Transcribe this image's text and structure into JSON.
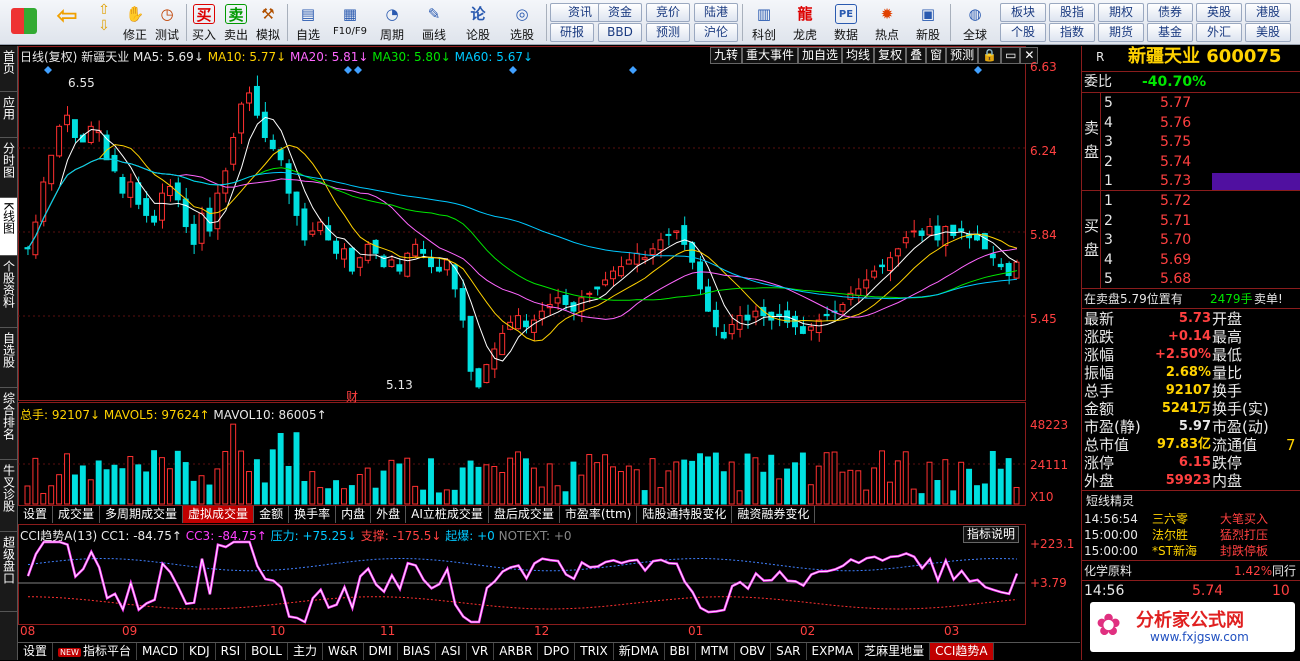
{
  "toolbar": {
    "buttons": [
      {
        "name": "app-icon",
        "label": ""
      },
      {
        "name": "back-button",
        "label": ""
      },
      {
        "name": "modify-button",
        "label": "修正"
      },
      {
        "name": "backtest-button",
        "label": "测试"
      },
      {
        "name": "buy-button",
        "label": "买入",
        "icon": "买"
      },
      {
        "name": "sell-button",
        "label": "卖出",
        "icon": "卖"
      },
      {
        "name": "simulate-button",
        "label": "模拟"
      },
      {
        "name": "watchlist-button",
        "label": "自选"
      },
      {
        "name": "f10-button",
        "label": "F10/F9"
      },
      {
        "name": "period-button",
        "label": "周期"
      },
      {
        "name": "draw-button",
        "label": "画线"
      },
      {
        "name": "forum-button",
        "label": "论股"
      },
      {
        "name": "stockpick-button",
        "label": "选股"
      }
    ],
    "grid_left": [
      [
        "资讯",
        "资金",
        "竞价",
        "陆港"
      ],
      [
        "研报",
        "BBD",
        "预测",
        "沪伦"
      ]
    ],
    "grid_right_buttons": [
      {
        "name": "kechuang-button",
        "label": "科创"
      },
      {
        "name": "dragon-tiger-button",
        "label": "龙虎"
      },
      {
        "name": "data-button",
        "label": "数据"
      },
      {
        "name": "hotspot-button",
        "label": "热点"
      },
      {
        "name": "ipo-button",
        "label": "新股"
      },
      {
        "name": "global-button",
        "label": "全球"
      }
    ],
    "grid_right": [
      [
        "板块",
        "股指",
        "期权",
        "债券",
        "英股",
        "港股"
      ],
      [
        "个股",
        "指数",
        "期货",
        "基金",
        "外汇",
        "美股"
      ]
    ]
  },
  "sidebar": {
    "tabs": [
      "首页",
      "应用",
      "分时图",
      "K线图",
      "个股资料",
      "自选股",
      "综合排名",
      "牛叉诊股",
      "超级盘口"
    ],
    "active": 3
  },
  "chart": {
    "header": {
      "period": "日线(复权)",
      "stock": "新疆天业",
      "ma5": "MA5: 5.69↓",
      "ma10": "MA10: 5.77↓",
      "ma20": "MA20: 5.81↓",
      "ma30": "MA30: 5.80↓",
      "ma60": "MA60: 5.67↓"
    },
    "buttons": [
      "九转",
      "重大事件",
      "加自选",
      "均线",
      "复权",
      "叠",
      "窗",
      "预测"
    ],
    "price_axis": [
      "6.63",
      "6.24",
      "5.84",
      "5.45"
    ],
    "high_label": "6.55",
    "low_label": "5.13",
    "event_label": "财",
    "vol_header": {
      "total": "总手: 92107↓",
      "mavol5": "MAVOL5: 97624↑",
      "mavol10": "MAVOL10: 86005↑"
    },
    "vol_axis": [
      "48223",
      "24111",
      "X10"
    ],
    "tabs": [
      "设置",
      "成交量",
      "多周期成交量",
      "虚拟成交量",
      "金额",
      "换手率",
      "内盘",
      "外盘",
      "AI立桩成交量",
      "盘后成交量",
      "市盈率(ttm)",
      "陆股通持股变化",
      "融资融券变化"
    ],
    "active_tab": 3,
    "cci_header": {
      "name": "CCI趋势A(13)",
      "cc1": "CC1: -84.75↑",
      "cc3": "CC3: -84.75↑",
      "pressure": "压力: +75.25↓",
      "support": "支撑: -175.5↓",
      "rise": "起爆: +0",
      "notext": "NOTEXT: +0"
    },
    "cci_button": "指标说明",
    "cci_axis": [
      "+223.1",
      "+3.79"
    ],
    "date_labels": [
      "08",
      "09",
      "10",
      "11",
      "12",
      "01",
      "02",
      "03"
    ]
  },
  "chart_data": {
    "type": "candlestick",
    "title": "新疆天业 日线(复权)",
    "ylim": [
      5.13,
      6.63
    ],
    "ma_last": {
      "MA5": 5.69,
      "MA10": 5.77,
      "MA20": 5.81,
      "MA30": 5.8,
      "MA60": 5.67
    },
    "close": [
      5.8,
      5.92,
      6.1,
      6.22,
      6.35,
      6.4,
      6.3,
      6.28,
      6.35,
      6.33,
      6.2,
      6.15,
      6.05,
      6.1,
      6.0,
      5.95,
      5.92,
      6.05,
      6.08,
      6.02,
      5.9,
      5.82,
      5.96,
      5.88,
      6.05,
      6.15,
      6.3,
      6.45,
      6.5,
      6.4,
      6.3,
      6.25,
      6.2,
      6.05,
      5.95,
      5.84,
      5.88,
      5.92,
      5.84,
      5.78,
      5.8,
      5.7,
      5.76,
      5.82,
      5.78,
      5.72,
      5.75,
      5.7,
      5.78,
      5.82,
      5.78,
      5.72,
      5.7,
      5.75,
      5.62,
      5.48,
      5.25,
      5.18,
      5.28,
      5.35,
      5.42,
      5.47,
      5.5,
      5.45,
      5.48,
      5.52,
      5.55,
      5.58,
      5.55,
      5.52,
      5.58,
      5.6,
      5.62,
      5.66,
      5.7,
      5.72,
      5.75,
      5.78,
      5.76,
      5.8,
      5.84,
      5.86,
      5.88,
      5.82,
      5.74,
      5.62,
      5.52,
      5.45,
      5.4,
      5.46,
      5.5,
      5.48,
      5.52,
      5.5,
      5.48,
      5.5,
      5.47,
      5.45,
      5.42,
      5.45,
      5.48,
      5.5,
      5.52,
      5.55,
      5.6,
      5.62,
      5.66,
      5.7,
      5.72,
      5.76,
      5.8,
      5.85,
      5.88,
      5.86,
      5.9,
      5.84,
      5.9,
      5.86,
      5.88,
      5.85,
      5.84,
      5.8,
      5.76,
      5.72,
      5.68,
      5.74
    ],
    "volume_max": 48223,
    "cci_range": [
      -300,
      223.1
    ]
  },
  "right_panel": {
    "code_prefix": "R",
    "title": "新疆天业 600075",
    "weibi_label": "委比",
    "weibi": "-40.70%",
    "sell_label": "卖盘",
    "buy_label": "买盘",
    "sell": [
      [
        "5",
        "5.77"
      ],
      [
        "4",
        "5.76"
      ],
      [
        "3",
        "5.75"
      ],
      [
        "2",
        "5.74"
      ],
      [
        "1",
        "5.73"
      ]
    ],
    "buy": [
      [
        "1",
        "5.72"
      ],
      [
        "2",
        "5.71"
      ],
      [
        "3",
        "5.70"
      ],
      [
        "4",
        "5.69"
      ],
      [
        "5",
        "5.68"
      ]
    ],
    "notice": "在卖盘5.79位置有",
    "notice_qty": "2479手",
    "notice_tail": "卖单!",
    "stats": [
      [
        "最新",
        "5.73",
        "开盘",
        ""
      ],
      [
        "涨跌",
        "+0.14",
        "最高",
        ""
      ],
      [
        "涨幅",
        "+2.50%",
        "最低",
        ""
      ],
      [
        "振幅",
        "2.68%",
        "量比",
        ""
      ],
      [
        "总手",
        "92107",
        "换手",
        ""
      ],
      [
        "金额",
        "5241万",
        "换手(实)",
        ""
      ],
      [
        "市盈(静)",
        "5.97",
        "市盈(动)",
        ""
      ],
      [
        "总市值",
        "97.83亿",
        "流通值",
        "7"
      ],
      [
        "涨停",
        "6.15",
        "跌停",
        ""
      ],
      [
        "外盘",
        "59923",
        "内盘",
        ""
      ]
    ],
    "short_title": "短线精灵",
    "short": [
      [
        "14:56:54",
        "三六零",
        "大笔买入"
      ],
      [
        "15:00:00",
        "法尔胜",
        "猛烈打压"
      ],
      [
        "15:00:00",
        "*ST新海",
        "封跌停板"
      ]
    ],
    "sector_label": "化学原料",
    "sector_pct": "1.42%",
    "sector_btn": "同行",
    "tick_time": "14:56",
    "tick_price": "5.74",
    "tick_qty": "10",
    "watermark_title": "分析家公式网",
    "watermark_url": "www.fxjgsw.com"
  },
  "bottom": {
    "items": [
      "设置",
      "指标平台",
      "MACD",
      "KDJ",
      "RSI",
      "BOLL",
      "主力",
      "W&R",
      "DMI",
      "BIAS",
      "ASI",
      "VR",
      "ARBR",
      "DPO",
      "TRIX",
      "新DMA",
      "BBI",
      "MTM",
      "OBV",
      "SAR",
      "EXPMA",
      "芝麻里地量",
      "CCI趋势A"
    ],
    "new_badge": "NEW",
    "active": 22
  }
}
